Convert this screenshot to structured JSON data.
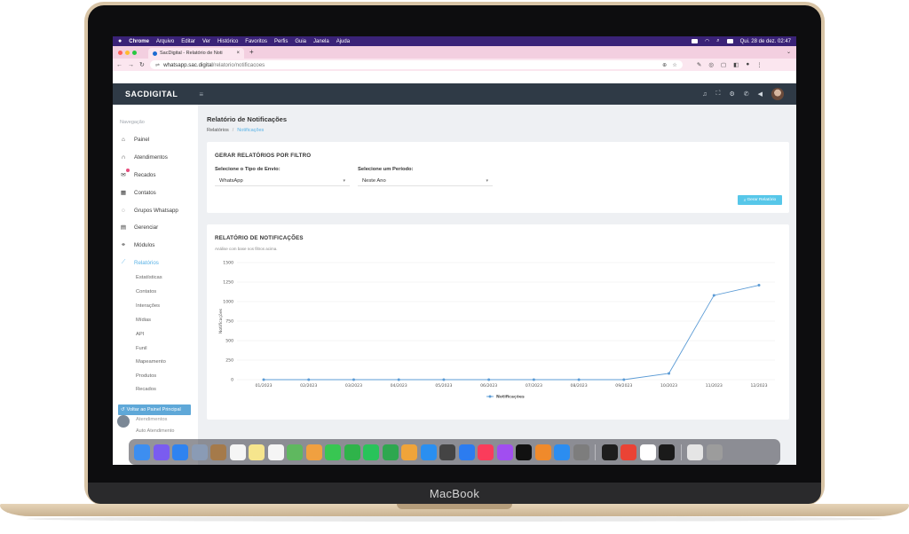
{
  "device": {
    "label": "MacBook"
  },
  "menubar": {
    "items": [
      "Chrome",
      "Arquivo",
      "Editar",
      "Ver",
      "Histórico",
      "Favoritos",
      "Perfis",
      "Guia",
      "Janela",
      "Ajuda"
    ],
    "clock": "Qui. 28 de dez.  02:47"
  },
  "browser": {
    "tab_title": "SacDigital - Relatório de Noti",
    "url_host": "whatsapp.sac.digital",
    "url_path": "/relatorio/notificacoes",
    "colors": {
      "tabstrip": "#f3cfe0",
      "toolbar": "#fbe6ef"
    }
  },
  "app": {
    "brand": "SACDIGITAL",
    "colors": {
      "header": "#2f3a46",
      "accent": "#58b2e6",
      "button": "#57c7e9"
    }
  },
  "sidebar": {
    "heading": "Navegação",
    "items": [
      {
        "label": "Painel",
        "icon": "home-icon"
      },
      {
        "label": "Atendimentos",
        "icon": "headset-icon"
      },
      {
        "label": "Recados",
        "icon": "message-icon"
      },
      {
        "label": "Contatos",
        "icon": "contacts-icon"
      },
      {
        "label": "Grupos Whatsapp",
        "icon": "whatsapp-icon"
      },
      {
        "label": "Gerenciar",
        "icon": "manage-icon"
      },
      {
        "label": "Módulos",
        "icon": "modules-icon"
      },
      {
        "label": "Relatórios",
        "icon": "chart-line-icon"
      }
    ],
    "subitems": [
      "Estatísticas",
      "Contatos",
      "Interações",
      "Mídias",
      "API",
      "Funil",
      "Mapeamento",
      "Produtos",
      "Recados",
      "Atendimentos"
    ],
    "back_button": "Voltar ao Painel Principal",
    "bottom_item": "Auto Atendimento"
  },
  "page": {
    "title": "Relatório de Notificações",
    "breadcrumb": [
      "Relatórios",
      "Notificações"
    ]
  },
  "filter_card": {
    "title": "GERAR RELATÓRIOS POR FILTRO",
    "send_type_label": "Selecione o Tipo de Envio:",
    "send_type_value": "WhatsApp",
    "period_label": "Selecione um Período:",
    "period_value": "Neste Ano",
    "generate_button": "Gerar Relatório"
  },
  "report_card": {
    "title": "RELATÓRIO DE NOTIFICAÇÕES",
    "subtitle": "Análise com base nos filtros acima."
  },
  "chart_data": {
    "type": "line",
    "categories": [
      "01/2023",
      "02/2023",
      "03/2023",
      "04/2023",
      "05/2023",
      "06/2023",
      "07/2023",
      "08/2023",
      "09/2023",
      "10/2023",
      "11/2023",
      "12/2023"
    ],
    "series": [
      {
        "name": "Notificações",
        "values": [
          0,
          0,
          0,
          0,
          0,
          0,
          0,
          0,
          0,
          80,
          1080,
          1210
        ],
        "color": "#5b9bd5"
      }
    ],
    "ylabel": "Notificações",
    "yticks": [
      0,
      250,
      500,
      750,
      1000,
      1250,
      1500
    ],
    "ylim": [
      0,
      1500
    ],
    "grid": true,
    "legend": "bottom-center"
  }
}
